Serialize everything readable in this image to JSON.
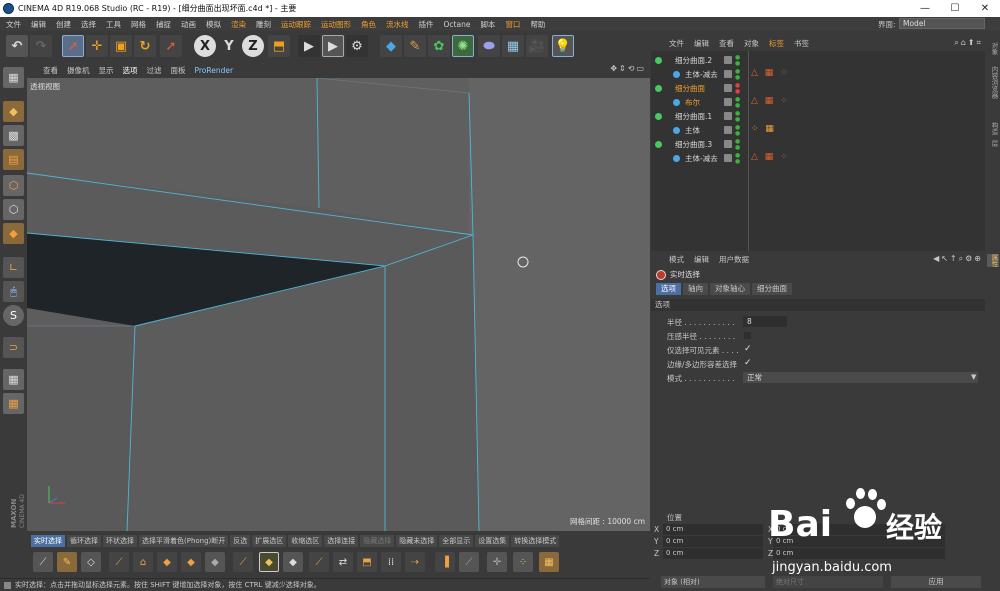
{
  "window": {
    "title": "CINEMA 4D R19.068 Studio (RC - R19) - [细分曲面出现坏面.c4d *] - 主要",
    "controls": [
      "—",
      "☐",
      "✕"
    ]
  },
  "menubar": {
    "items": [
      "文件",
      "编辑",
      "创建",
      "选择",
      "工具",
      "网格",
      "捕捉",
      "动画",
      "模拟",
      "渲染",
      "雕刻",
      "运动跟踪",
      "运动图形",
      "角色",
      "流水线",
      "插件",
      "Octane",
      "脚本",
      "窗口",
      "帮助"
    ],
    "layout_label": "界面:",
    "layout_value": "Model"
  },
  "viewport": {
    "menu": [
      "查看",
      "摄像机",
      "显示",
      "选项",
      "过滤",
      "面板",
      "ProRender"
    ],
    "label": "透视视图",
    "grid_info": "网格间距 : 10000 cm",
    "colors": {
      "bg": "#5b5b5b",
      "edge": "#4fb6d8",
      "dark": "#1e2328",
      "face": "#636363"
    }
  },
  "bottom_tabs": [
    "实时选择",
    "循环选择",
    "环状选择",
    "选择平滑着色(Phong)断开",
    "反选",
    "扩展选区",
    "收缩选区",
    "选择连接",
    "隐藏选择",
    "隐藏未选择",
    "全部显示",
    "设置选集",
    "转换选择模式"
  ],
  "status": {
    "text": "实时选择：点击并拖动鼠标选择元素。按住 SHIFT 键增加选择对象，按住 CTRL 键减少选择对象。"
  },
  "object_manager": {
    "menu": [
      "文件",
      "编辑",
      "查看",
      "对象",
      "标签",
      "书签"
    ],
    "rows": [
      {
        "name": "细分曲面.2",
        "level": 0,
        "selected": false,
        "tags": ""
      },
      {
        "name": "主体-减去",
        "level": 1,
        "selected": false,
        "tags": "△ ▦ ⁘"
      },
      {
        "name": "细分曲面",
        "level": 0,
        "selected": true,
        "tags": ""
      },
      {
        "name": "布尔",
        "level": 1,
        "selected": true,
        "tags": "△ ▦ ⁘"
      },
      {
        "name": "细分曲面.1",
        "level": 0,
        "selected": false,
        "tags": ""
      },
      {
        "name": "主体",
        "level": 1,
        "selected": false,
        "tags": "⁘ ▦"
      },
      {
        "name": "细分曲面.3",
        "level": 0,
        "selected": false,
        "tags": ""
      },
      {
        "name": "主体-减去",
        "level": 1,
        "selected": false,
        "tags": "△ ▦ ⁘"
      }
    ]
  },
  "right_strip_tabs": [
    "对象",
    "内容浏览器",
    "构造",
    "层",
    "属性"
  ],
  "attribute_manager": {
    "menu": [
      "模式",
      "编辑",
      "用户数据"
    ],
    "tool_name": "实时选择",
    "tabs": [
      "选项",
      "轴向",
      "对象轴心",
      "细分曲面"
    ],
    "section": "选项",
    "fields": [
      {
        "label": "半径 . . . . . . . . . . .",
        "value": "8",
        "type": "number"
      },
      {
        "label": "压感半径 . . . . . . . .",
        "value": "",
        "type": "checkbox"
      },
      {
        "label": "仅选择可见元素 . . . .",
        "value": "✓",
        "type": "checkbox"
      },
      {
        "label": "边缘/多边形容差选择",
        "value": "✓",
        "type": "checkbox"
      },
      {
        "label": "模式 . . . . . . . . . . .",
        "value": "正常",
        "type": "select"
      }
    ]
  },
  "coord_manager": {
    "header": "位置",
    "rows": [
      {
        "axis": "X",
        "value": "0 cm",
        "axis2": "X",
        "value2": "0 cm"
      },
      {
        "axis": "Y",
        "value": "0 cm",
        "axis2": "Y",
        "value2": "0 cm"
      },
      {
        "axis": "Z",
        "value": "0 cm",
        "axis2": "Z",
        "value2": "0 cm"
      }
    ],
    "mode_select": "对象 (相对)",
    "size_select": "绝对尺寸",
    "apply_label": "应用"
  },
  "watermark": {
    "brand": "Bai",
    "brand2": "经验",
    "url": "jingyan.baidu.com"
  },
  "logo": {
    "line1": "MAXON",
    "line2": "CINEMA 4D"
  }
}
